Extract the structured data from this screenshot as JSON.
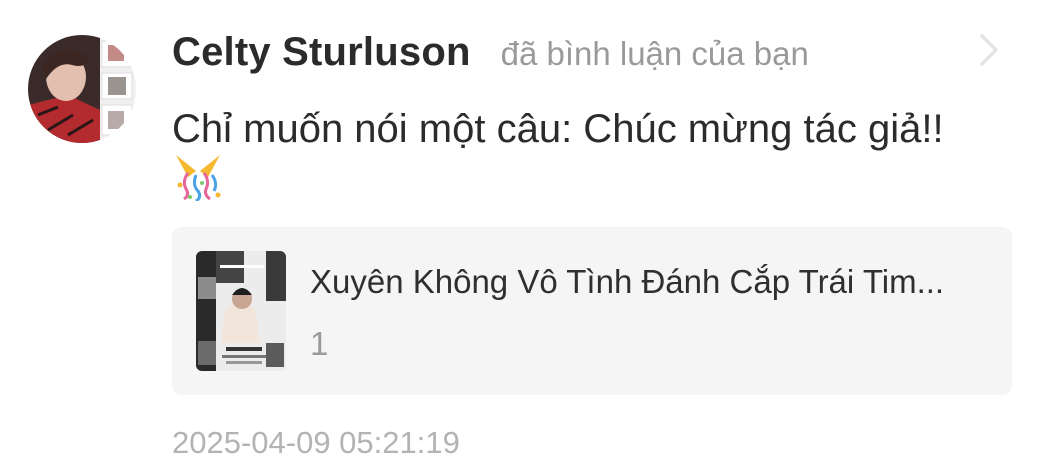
{
  "notification": {
    "username": "Celty Sturluson",
    "action": "đã bình luận của bạn",
    "comment": "Chỉ muốn nói một câu: Chúc mừng tác giả!!",
    "timestamp": "2025-04-09 05:21:19"
  },
  "story": {
    "title": "Xuyên Không Vô Tình Đánh Cắp Trái Tim...",
    "chapter": "1"
  },
  "icons": {
    "avatar": "user-avatar",
    "chevron": "chevron-right-icon",
    "confetti": "confetti-emoji-icon",
    "cover": "story-cover-image"
  },
  "colors": {
    "username": "#2b2b2b",
    "secondary": "#9a9a9a",
    "card_bg": "#f5f5f6",
    "timestamp": "#b3b3b3"
  }
}
